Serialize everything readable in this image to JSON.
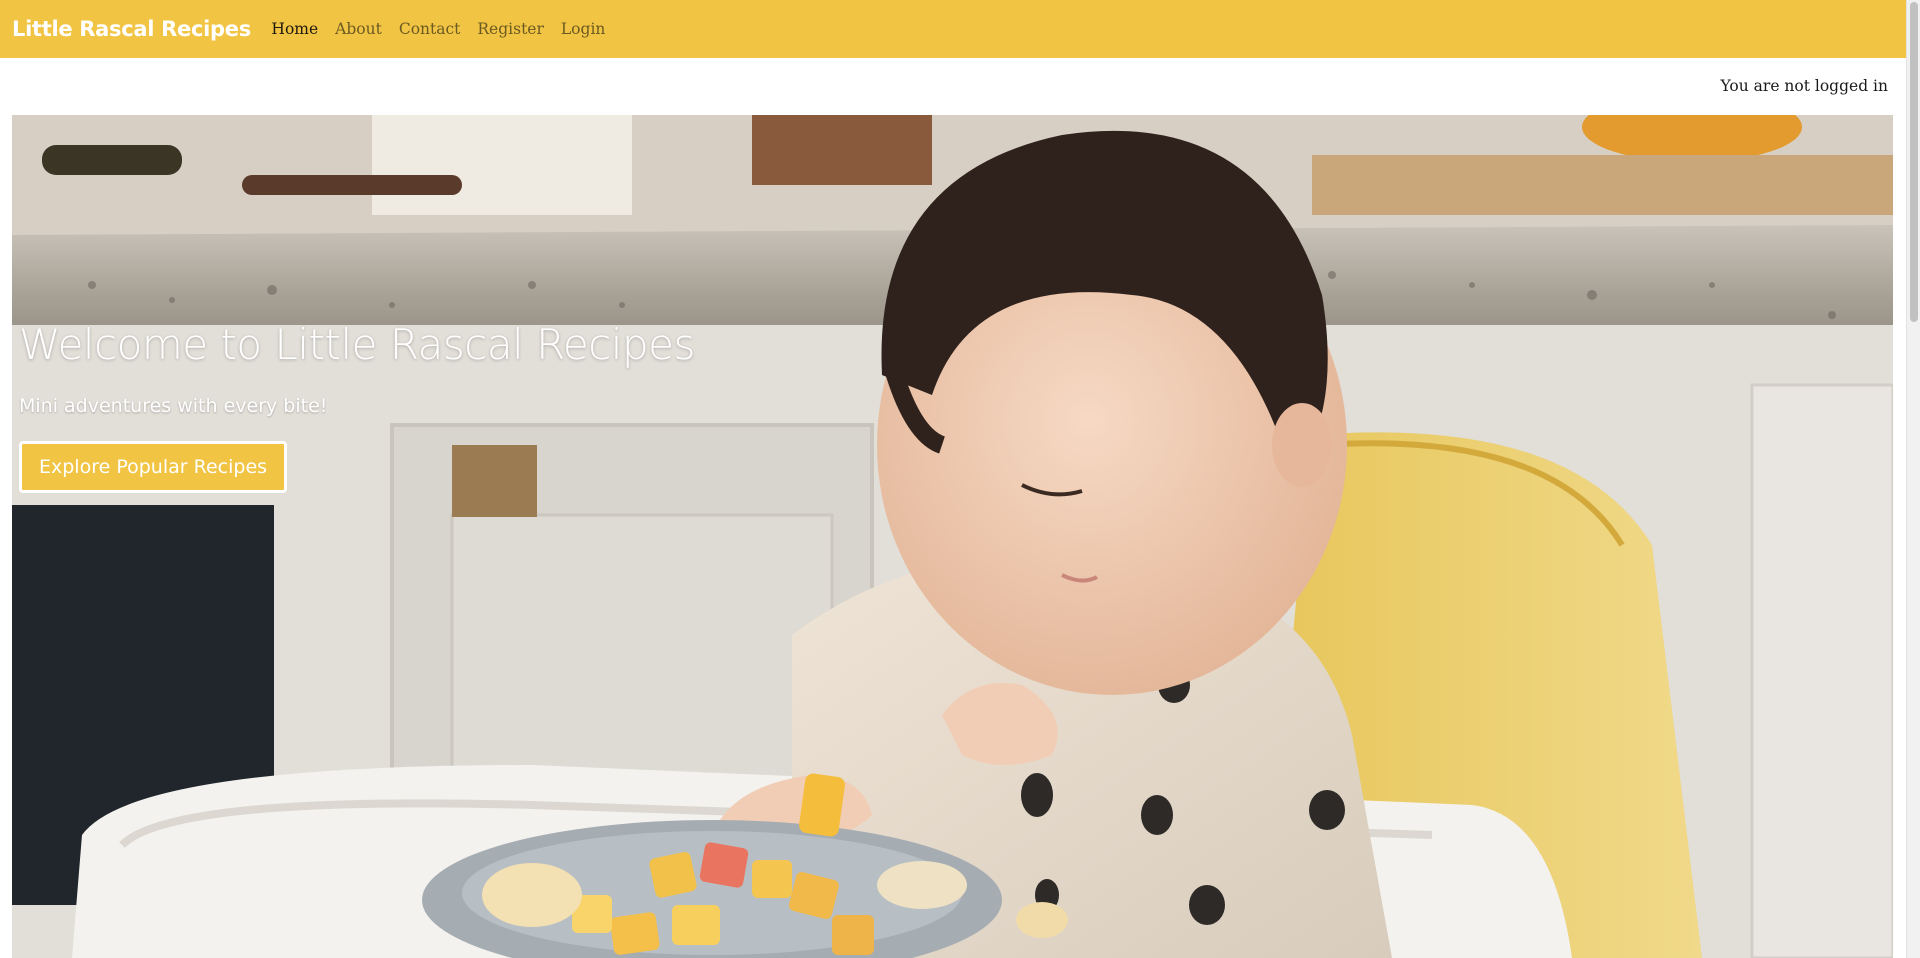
{
  "navbar": {
    "brand": "Little Rascal Recipes",
    "links": [
      {
        "label": "Home",
        "active": true
      },
      {
        "label": "About",
        "active": false
      },
      {
        "label": "Contact",
        "active": false
      },
      {
        "label": "Register",
        "active": false
      },
      {
        "label": "Login",
        "active": false
      }
    ]
  },
  "status": {
    "text": "You are not logged in"
  },
  "hero": {
    "title": "Welcome to Little Rascal Recipes",
    "subtitle": "Mini adventures with every bite!",
    "button_label": "Explore Popular Recipes",
    "image": "toddler-eating-fruit-photo"
  },
  "colors": {
    "accent": "#f2c443",
    "nav_text": "#6b5a22",
    "nav_active": "#1f1a0e"
  }
}
